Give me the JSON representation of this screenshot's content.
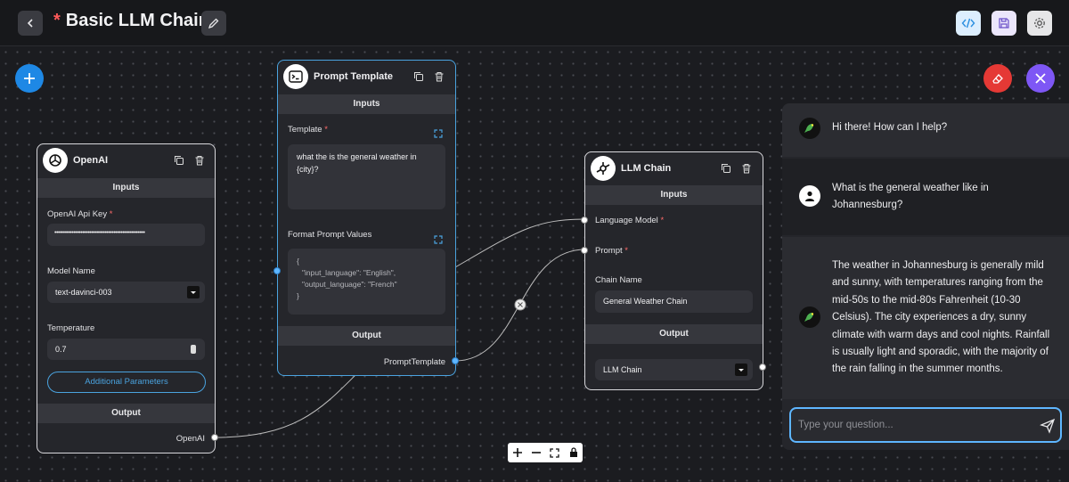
{
  "header": {
    "unsaved_marker": "*",
    "title": "Basic LLM Chain"
  },
  "nodes": {
    "openai": {
      "title": "OpenAI",
      "inputs_label": "Inputs",
      "api_key_label": "OpenAI Api Key",
      "api_key_value": "••••••••••••••••••••••••••••••••••••••••••••••••••••",
      "model_label": "Model Name",
      "model_value": "text-davinci-003",
      "temperature_label": "Temperature",
      "temperature_value": "0.7",
      "additional_params_label": "Additional Parameters",
      "output_label": "Output",
      "output_handle_label": "OpenAI"
    },
    "prompt": {
      "title": "Prompt Template",
      "inputs_label": "Inputs",
      "template_label": "Template",
      "template_line1": "what the is the general weather in",
      "template_line2": "{city}?",
      "format_label": "Format Prompt Values",
      "format_line1": "{",
      "format_line2": "\"input_language\": \"English\",",
      "format_line3": "\"output_language\": \"French\"",
      "format_line4": "}",
      "output_label": "Output",
      "output_handle_label": "PromptTemplate"
    },
    "llm_chain": {
      "title": "LLM Chain",
      "inputs_label": "Inputs",
      "language_model_label": "Language Model",
      "prompt_label": "Prompt",
      "chain_name_label": "Chain Name",
      "chain_name_value": "General Weather Chain",
      "output_label": "Output",
      "output_value": "LLM Chain"
    }
  },
  "chat": {
    "messages": [
      {
        "role": "bot",
        "text": "Hi there! How can I help?"
      },
      {
        "role": "user",
        "line1": "What is the general weather like in",
        "line2": "Johannesburg?"
      },
      {
        "role": "bot",
        "lines": [
          "The weather in Johannesburg is generally mild",
          "and sunny, with temperatures ranging from the",
          "mid-50s to the mid-80s Fahrenheit (10-30",
          "Celsius). The city experiences a dry, sunny",
          "climate with warm days and cool nights. Rainfall",
          "is usually light and sporadic, with the majority of",
          "the rain falling in the summer months."
        ]
      }
    ],
    "input_placeholder": "Type your question..."
  },
  "colors": {
    "accent_blue": "#1e88e5",
    "clear_red": "#e53935",
    "close_purple": "#7e57f5",
    "edge_color": "#bdbdbd"
  },
  "icons": {
    "back": "chevron-left-icon",
    "edit": "pencil-icon",
    "code": "code-icon",
    "save": "save-icon",
    "settings": "gear-icon",
    "add": "plus-icon",
    "clear": "eraser-icon",
    "close": "close-icon",
    "send": "send-icon"
  }
}
